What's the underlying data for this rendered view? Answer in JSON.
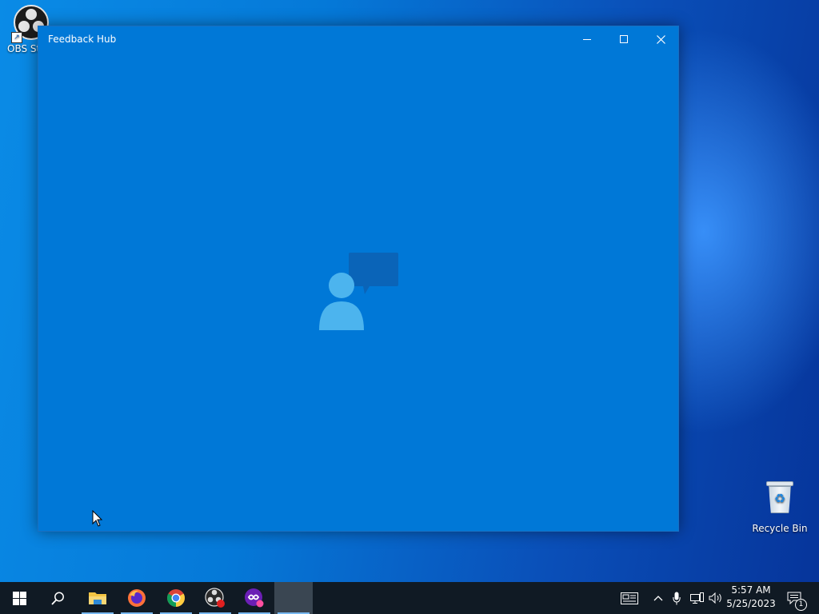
{
  "desktop": {
    "icons": [
      {
        "label": "OBS Stu",
        "icon": "obs-studio-icon"
      },
      {
        "label": "Recycle Bin",
        "icon": "recycle-bin-icon"
      }
    ]
  },
  "window": {
    "title": "Feedback Hub",
    "background": "#0078d7",
    "splash_icon": "feedback-hub-person-speech-icon",
    "controls": [
      "minimize",
      "maximize",
      "close"
    ]
  },
  "taskbar": {
    "background": "#101a24",
    "pinned": [
      {
        "name": "start",
        "icon": "windows-logo-icon"
      },
      {
        "name": "search",
        "icon": "search-icon"
      },
      {
        "name": "file-explorer",
        "icon": "folder-icon",
        "running": true
      },
      {
        "name": "firefox",
        "icon": "firefox-icon",
        "running": true
      },
      {
        "name": "chrome",
        "icon": "chrome-icon",
        "running": true
      },
      {
        "name": "obs-studio",
        "icon": "obs-icon",
        "running": true
      },
      {
        "name": "purple-app",
        "icon": "purple-app-icon",
        "running": true
      },
      {
        "name": "feedback-hub",
        "icon": "blank-active-icon",
        "active": true
      }
    ],
    "tray": {
      "time": "5:57 AM",
      "date": "5/25/2023",
      "notifications_count": "1"
    }
  }
}
